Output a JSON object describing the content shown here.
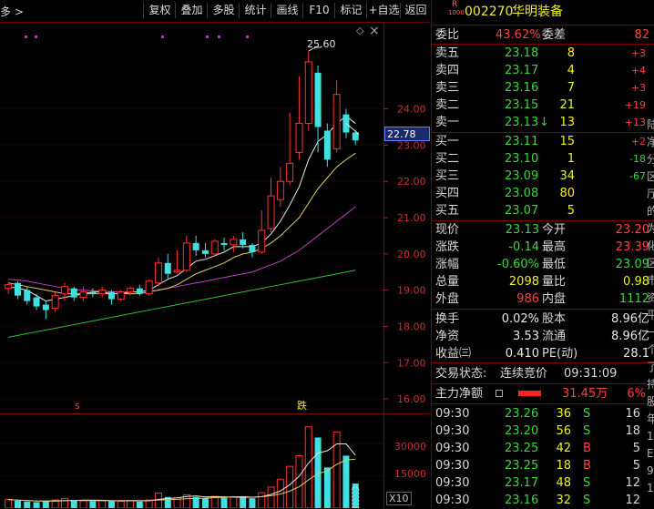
{
  "toolbar": {
    "left_text": "多 >",
    "buttons": [
      "复权",
      "叠加",
      "多股",
      "统计",
      "画线",
      "F10",
      "标记",
      "+自选",
      "返回"
    ]
  },
  "chart": {
    "price_labels": [
      "24.00",
      "23.00",
      "22.00",
      "21.00",
      "20.00",
      "19.00",
      "18.00",
      "17.00",
      "16.00"
    ],
    "current_price_tag": "22.78",
    "peak_label": "25.60",
    "marker_s": "s",
    "marker_fall": "跌",
    "vol_labels": [
      "30000",
      "15000"
    ],
    "vol_unit": "X10",
    "diamond": "◇",
    "close_x": "×"
  },
  "chart_data": {
    "type": "candlestick",
    "ylim": [
      15.6,
      25.9
    ],
    "candles": [
      {
        "o": 19.05,
        "h": 19.2,
        "l": 18.9,
        "c": 19.15
      },
      {
        "o": 19.2,
        "h": 19.25,
        "l": 18.75,
        "c": 18.85
      },
      {
        "o": 19.0,
        "h": 19.1,
        "l": 18.6,
        "c": 18.7
      },
      {
        "o": 18.8,
        "h": 18.9,
        "l": 18.45,
        "c": 18.55
      },
      {
        "o": 18.6,
        "h": 18.7,
        "l": 18.2,
        "c": 18.45
      },
      {
        "o": 18.5,
        "h": 18.95,
        "l": 18.4,
        "c": 18.85
      },
      {
        "o": 18.9,
        "h": 19.2,
        "l": 18.7,
        "c": 19.1
      },
      {
        "o": 19.05,
        "h": 19.1,
        "l": 18.7,
        "c": 18.8
      },
      {
        "o": 18.8,
        "h": 19.1,
        "l": 18.7,
        "c": 18.95
      },
      {
        "o": 18.95,
        "h": 19.05,
        "l": 18.8,
        "c": 18.9
      },
      {
        "o": 18.9,
        "h": 19.1,
        "l": 18.8,
        "c": 19.0
      },
      {
        "o": 18.95,
        "h": 19.0,
        "l": 18.6,
        "c": 18.75
      },
      {
        "o": 18.75,
        "h": 19.0,
        "l": 18.7,
        "c": 18.95
      },
      {
        "o": 18.95,
        "h": 19.1,
        "l": 18.85,
        "c": 19.05
      },
      {
        "o": 19.05,
        "h": 19.15,
        "l": 18.85,
        "c": 18.9
      },
      {
        "o": 18.9,
        "h": 19.3,
        "l": 18.85,
        "c": 19.25
      },
      {
        "o": 19.2,
        "h": 19.9,
        "l": 19.1,
        "c": 19.75
      },
      {
        "o": 19.75,
        "h": 20.0,
        "l": 19.3,
        "c": 19.45
      },
      {
        "o": 19.5,
        "h": 20.1,
        "l": 19.45,
        "c": 19.55
      },
      {
        "o": 19.55,
        "h": 20.5,
        "l": 19.5,
        "c": 20.3
      },
      {
        "o": 20.3,
        "h": 20.5,
        "l": 19.95,
        "c": 20.1
      },
      {
        "o": 20.1,
        "h": 20.3,
        "l": 19.9,
        "c": 20.0
      },
      {
        "o": 20.0,
        "h": 20.4,
        "l": 19.95,
        "c": 20.35
      },
      {
        "o": 20.3,
        "h": 20.45,
        "l": 20.1,
        "c": 20.25
      },
      {
        "o": 20.25,
        "h": 20.5,
        "l": 20.05,
        "c": 20.4
      },
      {
        "o": 20.4,
        "h": 20.6,
        "l": 20.15,
        "c": 20.25
      },
      {
        "o": 20.25,
        "h": 20.3,
        "l": 19.9,
        "c": 20.05
      },
      {
        "o": 20.05,
        "h": 21.2,
        "l": 20.0,
        "c": 20.65
      },
      {
        "o": 20.7,
        "h": 22.1,
        "l": 20.6,
        "c": 21.6
      },
      {
        "o": 21.5,
        "h": 22.4,
        "l": 21.3,
        "c": 22.0
      },
      {
        "o": 22.0,
        "h": 23.9,
        "l": 21.9,
        "c": 22.5
      },
      {
        "o": 22.8,
        "h": 24.9,
        "l": 22.6,
        "c": 23.6
      },
      {
        "o": 23.6,
        "h": 25.6,
        "l": 23.4,
        "c": 25.3
      },
      {
        "o": 25.0,
        "h": 25.2,
        "l": 22.8,
        "c": 23.5
      },
      {
        "o": 23.4,
        "h": 23.6,
        "l": 22.4,
        "c": 22.6
      },
      {
        "o": 22.9,
        "h": 24.8,
        "l": 22.8,
        "c": 24.4
      },
      {
        "o": 23.85,
        "h": 24.0,
        "l": 23.2,
        "c": 23.35
      },
      {
        "o": 23.35,
        "h": 23.4,
        "l": 23.0,
        "c": 23.13
      }
    ],
    "ma5": [
      19.1,
      19.05,
      19.0,
      18.85,
      18.7,
      18.75,
      18.8,
      18.85,
      18.9,
      18.95,
      18.95,
      18.9,
      18.9,
      18.95,
      18.95,
      19.0,
      19.15,
      19.3,
      19.4,
      19.6,
      19.8,
      19.85,
      19.95,
      20.05,
      20.2,
      20.2,
      20.2,
      20.3,
      20.55,
      20.9,
      21.35,
      21.85,
      22.6,
      23.1,
      23.3,
      23.6,
      23.8,
      23.6
    ],
    "ma10": [
      19.2,
      19.15,
      19.1,
      19.05,
      19.0,
      18.95,
      18.9,
      18.9,
      18.9,
      18.9,
      18.9,
      18.9,
      18.9,
      18.9,
      18.9,
      18.95,
      19.0,
      19.05,
      19.15,
      19.3,
      19.45,
      19.55,
      19.65,
      19.75,
      19.9,
      20.0,
      20.05,
      20.15,
      20.3,
      20.5,
      20.75,
      21.0,
      21.4,
      21.8,
      22.1,
      22.4,
      22.6,
      22.78
    ],
    "ma20": [
      19.3,
      19.28,
      19.25,
      19.2,
      19.15,
      19.1,
      19.05,
      19.0,
      19.0,
      18.98,
      18.97,
      18.96,
      18.95,
      18.95,
      18.96,
      18.97,
      19.0,
      19.05,
      19.1,
      19.15,
      19.2,
      19.25,
      19.3,
      19.35,
      19.4,
      19.45,
      19.5,
      19.6,
      19.7,
      19.8,
      19.95,
      20.1,
      20.3,
      20.5,
      20.7,
      20.9,
      21.1,
      21.3
    ],
    "ma60": [
      17.7,
      17.75,
      17.8,
      17.85,
      17.9,
      17.95,
      18.0,
      18.05,
      18.1,
      18.15,
      18.2,
      18.25,
      18.3,
      18.35,
      18.4,
      18.45,
      18.5,
      18.55,
      18.6,
      18.65,
      18.7,
      18.75,
      18.8,
      18.85,
      18.9,
      18.95,
      19.0,
      19.05,
      19.1,
      19.15,
      19.2,
      19.25,
      19.3,
      19.35,
      19.4,
      19.45,
      19.5,
      19.55
    ],
    "volume": [
      4000,
      3500,
      3000,
      2800,
      3200,
      3800,
      4500,
      3600,
      3400,
      3300,
      3500,
      3600,
      3200,
      3400,
      3000,
      3800,
      7000,
      5200,
      4800,
      6200,
      5200,
      4600,
      5500,
      4800,
      5300,
      5000,
      4600,
      7200,
      9800,
      13500,
      19500,
      24500,
      38000,
      33000,
      19000,
      35500,
      24500,
      11500
    ],
    "vol_ylim": [
      0,
      40000
    ]
  },
  "panel": {
    "code": "002270",
    "name": "华明装备",
    "badge_top": "R",
    "badge_bottom": "1000",
    "weibi_label": "委比",
    "weibi_value": "43.62%",
    "weicha_label": "委差",
    "weicha_value": "82",
    "asks": [
      {
        "label": "卖五",
        "price": "23.18",
        "vol": "8",
        "chg": "+3"
      },
      {
        "label": "卖四",
        "price": "23.17",
        "vol": "4",
        "chg": "+4"
      },
      {
        "label": "卖三",
        "price": "23.16",
        "vol": "7",
        "chg": "+3"
      },
      {
        "label": "卖二",
        "price": "23.15",
        "vol": "21",
        "chg": "+19"
      },
      {
        "label": "卖一",
        "price": "23.13",
        "vol": "13",
        "chg": "+13"
      }
    ],
    "ask1_arrow": "↓",
    "bids": [
      {
        "label": "买一",
        "price": "23.11",
        "vol": "15",
        "chg": "+2"
      },
      {
        "label": "买二",
        "price": "23.10",
        "vol": "1",
        "chg": "-18"
      },
      {
        "label": "买三",
        "price": "23.09",
        "vol": "34",
        "chg": "-67"
      },
      {
        "label": "买四",
        "price": "23.08",
        "vol": "80",
        "chg": ""
      },
      {
        "label": "买五",
        "price": "23.07",
        "vol": "5",
        "chg": ""
      }
    ],
    "stats": [
      {
        "l1": "现价",
        "v1": "23.13",
        "l2": "今开",
        "v2": "23.20"
      },
      {
        "l1": "涨跌",
        "v1": "-0.14",
        "l2": "最高",
        "v2": "23.39"
      },
      {
        "l1": "涨幅",
        "v1": "-0.60%",
        "l2": "最低",
        "v2": "23.09"
      },
      {
        "l1": "总量",
        "v1": "2098",
        "l2": "量比",
        "v2": "0.98"
      },
      {
        "l1": "外盘",
        "v1": "986",
        "l2": "内盘",
        "v2": "1112"
      }
    ],
    "stats2": [
      {
        "l1": "换手",
        "v1": "0.02%",
        "l2": "股本",
        "v2": "8.96亿"
      },
      {
        "l1": "净资",
        "v1": "3.53",
        "l2": "流通",
        "v2": "8.96亿"
      },
      {
        "l1": "收益㈢",
        "v1": "0.410",
        "l2": "PE(动)",
        "v2": "28.1"
      }
    ],
    "status_label": "交易状态:",
    "status_value": "连续竞价",
    "status_time": "09:31:09",
    "main_flow_label": "主力净额",
    "main_flow_value": "31.45万",
    "main_flow_pct": "6%",
    "trades": [
      {
        "time": "09:30",
        "price": "23.26",
        "vol": "36",
        "dir": "S",
        "n": "16"
      },
      {
        "time": "09:30",
        "price": "23.20",
        "vol": "56",
        "dir": "S",
        "n": "18"
      },
      {
        "time": "09:30",
        "price": "23.25",
        "vol": "42",
        "dir": "B",
        "n": "5"
      },
      {
        "time": "09:30",
        "price": "23.25",
        "vol": "18",
        "dir": "B",
        "n": "5"
      },
      {
        "time": "09:30",
        "price": "23.17",
        "vol": "48",
        "dir": "S",
        "n": "12"
      },
      {
        "time": "09:30",
        "price": "23.16",
        "vol": "32",
        "dir": "S",
        "n": "12"
      }
    ],
    "side_chars": [
      "陆",
      "净",
      "分",
      "区",
      "厅",
      "的",
      "为",
      "化",
      "区",
      "市",
      "资",
      "平",
      "一",
      "个",
      "了",
      "持",
      "股",
      "年",
      "1",
      "E",
      "9",
      "1"
    ]
  }
}
